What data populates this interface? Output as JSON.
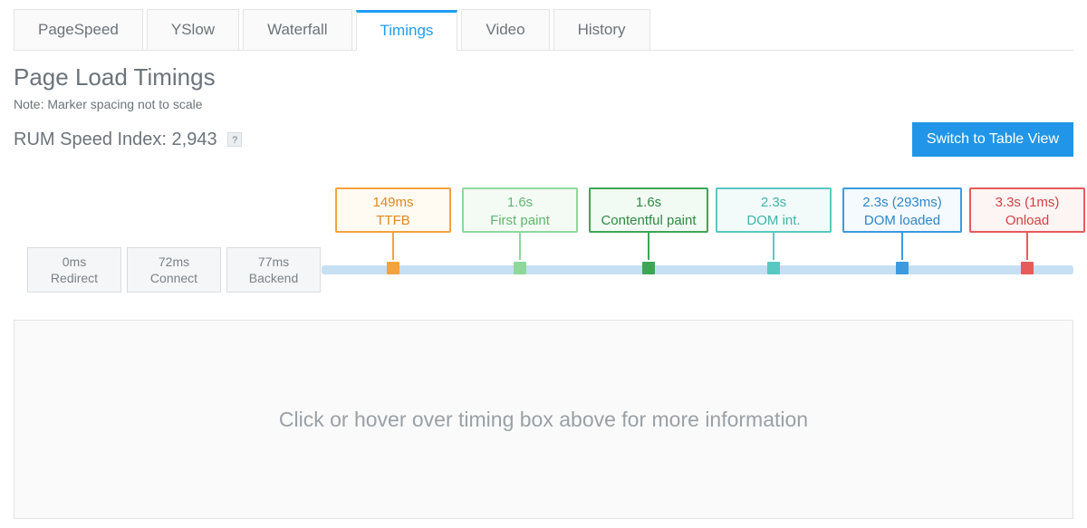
{
  "tabs": [
    {
      "label": "PageSpeed",
      "active": false
    },
    {
      "label": "YSlow",
      "active": false
    },
    {
      "label": "Waterfall",
      "active": false
    },
    {
      "label": "Timings",
      "active": true
    },
    {
      "label": "Video",
      "active": false
    },
    {
      "label": "History",
      "active": false
    }
  ],
  "page_title": "Page Load Timings",
  "note": "Note: Marker spacing not to scale",
  "speed_index_label": "RUM Speed Index: ",
  "speed_index_value": "2,943",
  "help_symbol": "?",
  "switch_button": "Switch to Table View",
  "preboxes": [
    {
      "value": "0ms",
      "label": "Redirect"
    },
    {
      "value": "72ms",
      "label": "Connect"
    },
    {
      "value": "77ms",
      "label": "Backend"
    }
  ],
  "timings": [
    {
      "value": "149ms",
      "label": "TTFB",
      "color": "orange",
      "pos": 355
    },
    {
      "value": "1.6s",
      "label": "First paint",
      "color": "lgreen",
      "pos": 495
    },
    {
      "value": "1.6s",
      "label": "Contentful paint",
      "color": "green",
      "pos": 635
    },
    {
      "value": "2.3s",
      "label": "DOM int.",
      "color": "teal",
      "pos": 775
    },
    {
      "value": "2.3s (293ms)",
      "label": "DOM loaded",
      "color": "blue",
      "pos": 915
    },
    {
      "value": "3.3s (1ms)",
      "label": "Onload",
      "color": "red",
      "pos": 1055
    }
  ],
  "info_text": "Click or hover over timing box above for more information"
}
